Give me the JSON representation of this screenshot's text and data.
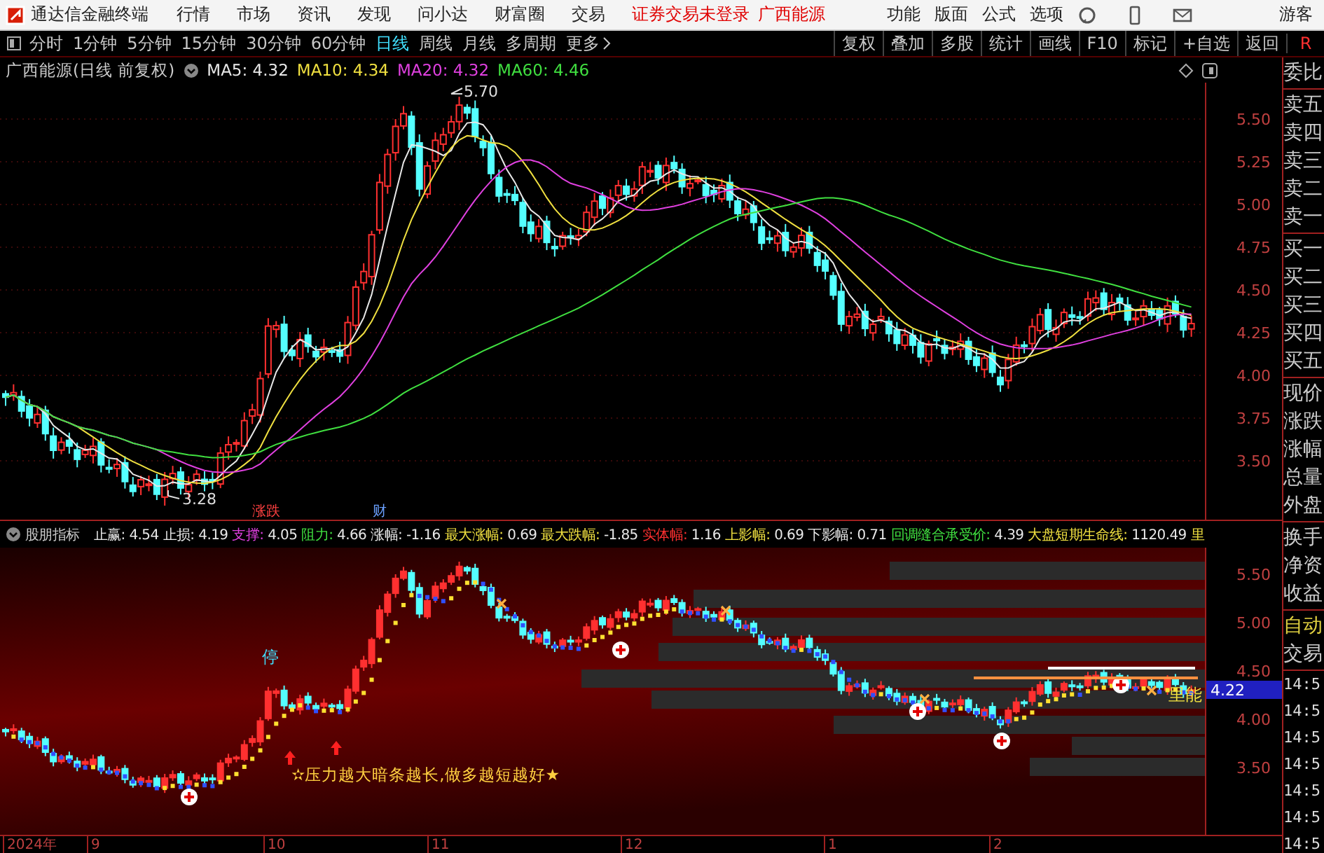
{
  "menubar": {
    "title": "通达信金融终端",
    "menus": [
      "行情",
      "市场",
      "资讯",
      "发现",
      "问小达",
      "财富圈",
      "交易"
    ],
    "status": "证券交易未登录",
    "stock": "广西能源",
    "tools": [
      "功能",
      "版面",
      "公式",
      "选项"
    ],
    "user": "游客"
  },
  "period_bar": {
    "periods": [
      {
        "label": "分时",
        "selected": false,
        "kind": "period"
      },
      {
        "label": "1分钟",
        "selected": false,
        "kind": "period"
      },
      {
        "label": "5分钟",
        "selected": false,
        "kind": "period"
      },
      {
        "label": "15分钟",
        "selected": false,
        "kind": "period"
      },
      {
        "label": "30分钟",
        "selected": false,
        "kind": "period"
      },
      {
        "label": "60分钟",
        "selected": false,
        "kind": "period"
      },
      {
        "label": "日线",
        "selected": true,
        "kind": "period"
      },
      {
        "label": "周线",
        "selected": false,
        "kind": "period"
      },
      {
        "label": "月线",
        "selected": false,
        "kind": "period"
      },
      {
        "label": "多周期",
        "selected": false,
        "kind": "period"
      },
      {
        "label": "更多",
        "selected": false,
        "kind": "more"
      }
    ],
    "buttons": [
      "复权",
      "叠加",
      "多股",
      "统计",
      "画线",
      "F10",
      "标记",
      "+自选",
      "返回"
    ],
    "corner": "R"
  },
  "main_chart": {
    "title": "广西能源(日线 前复权)",
    "ma": [
      {
        "label": "MA5: 4.32",
        "color": "#e8e8e8"
      },
      {
        "label": "MA10: 4.34",
        "color": "#f0e040"
      },
      {
        "label": "MA20: 4.32",
        "color": "#e040e0"
      },
      {
        "label": "MA60: 4.46",
        "color": "#40e040"
      }
    ],
    "price_axis": [
      "5.50",
      "5.25",
      "5.00",
      "4.75",
      "4.50",
      "4.25",
      "4.00",
      "3.75",
      "3.50"
    ],
    "high_label": "5.70",
    "low_label": "3.28",
    "markers": [
      {
        "text": "涨跌",
        "color": "#ff4040"
      },
      {
        "text": "财",
        "color": "#6aa0ff"
      }
    ]
  },
  "indicator": {
    "name": "股朋指标",
    "values": [
      {
        "label": "止赢:",
        "value": "4.54",
        "color": "#e8e8e8"
      },
      {
        "label": "止损:",
        "value": "4.19",
        "color": "#e8e8e8"
      },
      {
        "label": "支撑:",
        "value": "4.05",
        "color": "#e040e0"
      },
      {
        "label": "阻力:",
        "value": "4.66",
        "color": "#40e040"
      },
      {
        "label": "涨幅:",
        "value": "-1.16",
        "color": "#e8e8e8"
      },
      {
        "label": "最大涨幅:",
        "value": "0.69",
        "color": "#f0e040"
      },
      {
        "label": "最大跌幅:",
        "value": "-1.85",
        "color": "#f0e040"
      },
      {
        "label": "实体幅:",
        "value": "1.16",
        "color": "#ff3030"
      },
      {
        "label": "上影幅:",
        "value": "0.69",
        "color": "#f0e040"
      },
      {
        "label": "下影幅:",
        "value": "0.71",
        "color": "#e8e8e8"
      },
      {
        "label": "回调缝合承受价:",
        "value": "4.39",
        "color": "#40e040"
      },
      {
        "label": "大盘短期生命线:",
        "value": "1120.49",
        "color": "#f0e040"
      },
      {
        "label": "里",
        "color": "#f0e040"
      }
    ],
    "price_axis": [
      "5.50",
      "5.00",
      "4.50",
      "4.00",
      "3.50"
    ],
    "stop_label": "停",
    "energy_label": "里能",
    "price_tag": "4.22",
    "slogan": "✫压力越大暗条越长,做多越短越好★"
  },
  "date_axis": [
    "2024年",
    "9",
    "10",
    "11",
    "12",
    "1",
    "2"
  ],
  "sidebar": {
    "quote": [
      [
        "委比"
      ],
      [
        "卖五",
        "卖四",
        "卖三",
        "卖二",
        "卖一"
      ],
      [
        "买一",
        "买二",
        "买三",
        "买四",
        "买五"
      ],
      [
        "现价",
        "涨跌",
        "涨幅",
        "总量",
        "外盘"
      ],
      [
        "换手",
        "净资",
        "收益"
      ]
    ],
    "trade": [
      {
        "label": "自动",
        "kind": "mode"
      },
      {
        "label": "交易",
        "kind": "plain"
      }
    ],
    "times": [
      "14:5",
      "14:5",
      "14:5",
      "14:5",
      "14:5",
      "14:5",
      "14:5"
    ]
  }
}
